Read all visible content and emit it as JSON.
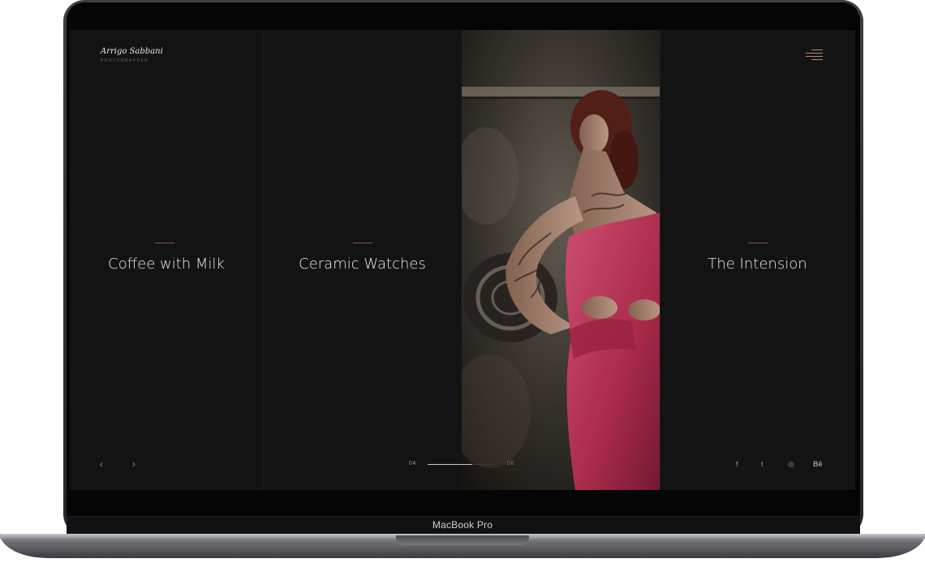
{
  "device": {
    "label": "MacBook Pro"
  },
  "brand": {
    "name": "Arrigo Sabbani",
    "subtitle": "PHOTOGRAPHER"
  },
  "slides": [
    {
      "title": "Coffee with Milk"
    },
    {
      "title": "Ceramic Watches"
    },
    {
      "title": "The Intension"
    }
  ],
  "pagination": {
    "current": "04",
    "total": "06",
    "progress": 0.67
  },
  "nav": {
    "prev": "‹",
    "next": "›"
  },
  "social": {
    "facebook": "f",
    "twitter": "t",
    "instagram": "◎",
    "behance": "Bē"
  },
  "colors": {
    "background": "#131314",
    "accent": "#b78a63",
    "text": "#e8e8e8"
  }
}
